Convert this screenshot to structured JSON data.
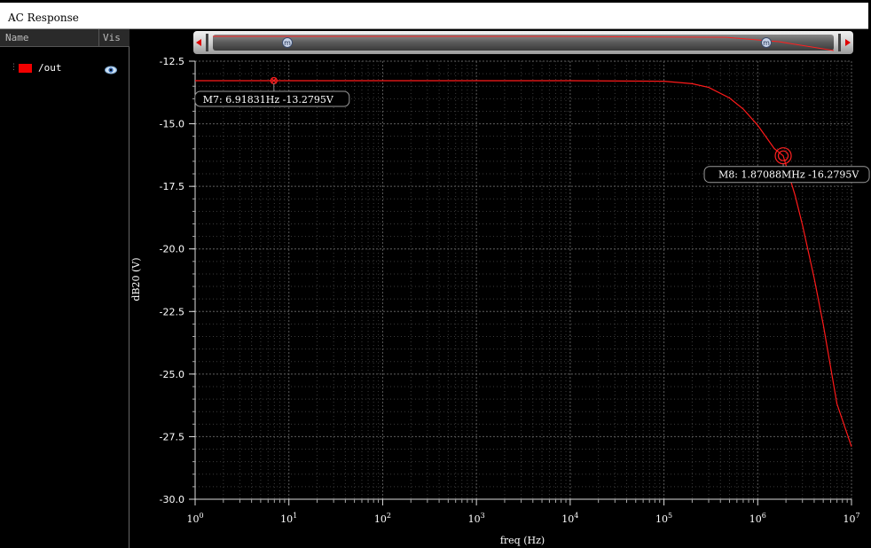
{
  "window": {
    "title": "AC Response"
  },
  "legend_panel": {
    "col_name": "Name",
    "col_vis": "Vis",
    "signals": [
      {
        "name": "/out",
        "color": "#ff0000",
        "visible_icon": "eye-icon"
      }
    ]
  },
  "scrollbar": {
    "marker_glyph": "m"
  },
  "chart_data": {
    "type": "line",
    "xlabel": "freq (Hz)",
    "ylabel": "dB20 (V)",
    "x_scale": "log",
    "xlim": [
      1,
      10000000
    ],
    "ylim": [
      -30.0,
      -12.5
    ],
    "grid": true,
    "x_tick_base": "10",
    "x_tick_exponents": [
      "0",
      "1",
      "2",
      "3",
      "4",
      "5",
      "6",
      "7"
    ],
    "y_ticks": [
      "-12.5",
      "-15.0",
      "-17.5",
      "-20.0",
      "-22.5",
      "-25.0",
      "-27.5",
      "-30.0"
    ],
    "series": [
      {
        "name": "/out",
        "color": "#ff1a1a",
        "x": [
          1,
          10,
          100,
          1000,
          10000,
          100000,
          200000,
          300000,
          500000,
          700000,
          1000000,
          1500000,
          1870880,
          2500000,
          3000000,
          4000000,
          5000000,
          7000000,
          10000000
        ],
        "y": [
          -13.28,
          -13.28,
          -13.28,
          -13.28,
          -13.28,
          -13.3,
          -13.4,
          -13.55,
          -13.97,
          -14.41,
          -15.06,
          -15.99,
          -16.28,
          -17.86,
          -19.04,
          -21.16,
          -23.03,
          -26.19,
          -27.9
        ]
      }
    ],
    "markers": [
      {
        "label": "M7: 6.91831Hz -13.2795V",
        "x": 6.91831,
        "y": -13.2795
      },
      {
        "label": "M8: 1.87088MHz -16.2795V",
        "x": 1870880,
        "y": -16.2795
      }
    ]
  }
}
